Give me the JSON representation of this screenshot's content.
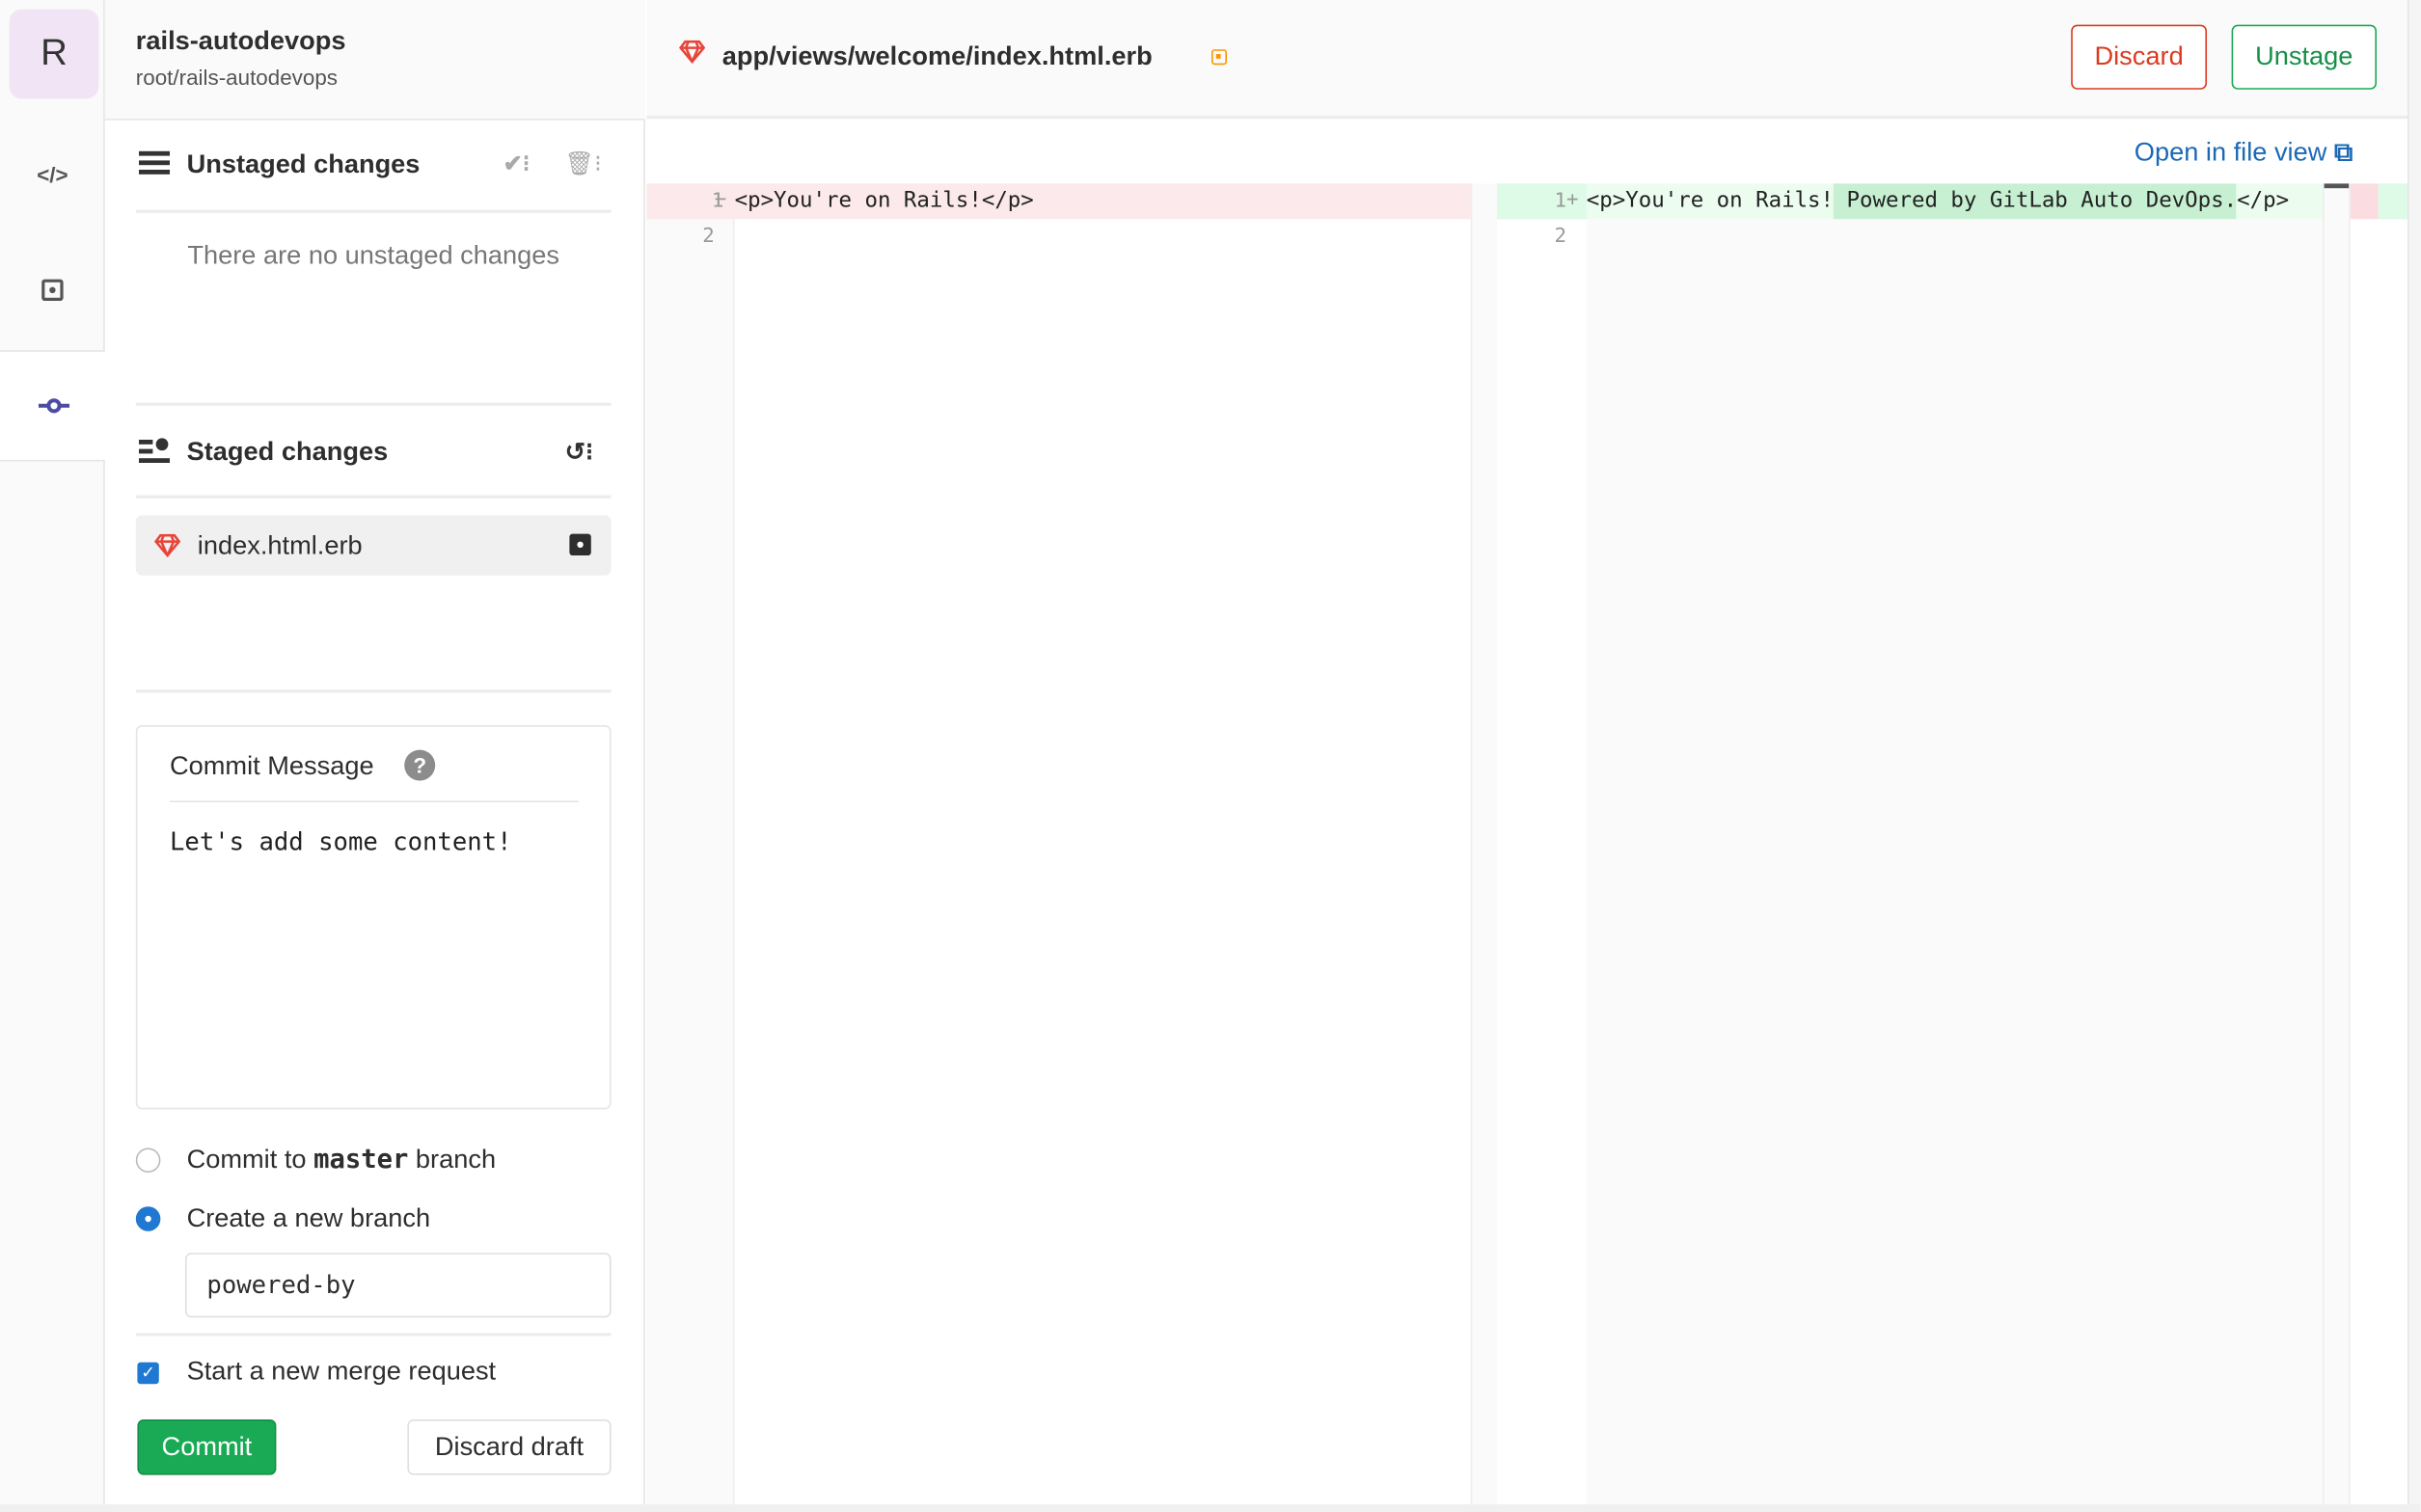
{
  "project": {
    "avatar_letter": "R",
    "name": "rails-autodevops",
    "path": "root/rails-autodevops"
  },
  "rail": {
    "items": [
      {
        "icon": "code-icon"
      },
      {
        "icon": "review-icon"
      },
      {
        "icon": "commit-icon",
        "active": true
      }
    ]
  },
  "unstaged": {
    "title": "Unstaged changes",
    "empty_text": "There are no unstaged changes"
  },
  "staged": {
    "title": "Staged changes",
    "files": [
      {
        "name": "index.html.erb",
        "icon": "ruby-gem-icon"
      }
    ]
  },
  "commit_form": {
    "message_label": "Commit Message",
    "message_value": "Let's add some content!",
    "option_master_prefix": "Commit to ",
    "option_master_branch": "master",
    "option_master_suffix": " branch",
    "option_new_branch": "Create a new branch",
    "selected_option": "new-branch",
    "branch_name": "powered-by",
    "merge_request_label": "Start a new merge request",
    "merge_request_checked": true,
    "commit_label": "Commit",
    "discard_draft_label": "Discard draft"
  },
  "editor": {
    "file_path": "app/views/welcome/index.html.erb",
    "discard_label": "Discard",
    "unstage_label": "Unstage",
    "open_file_view_label": "Open in file view",
    "left": {
      "lines": [
        {
          "num": "1",
          "marker": "−",
          "text": "<p>You're on Rails!</p>"
        },
        {
          "num": "2",
          "marker": "",
          "text": ""
        }
      ]
    },
    "right": {
      "lines": [
        {
          "num": "1",
          "marker": "+",
          "text_plain": "<p>You're on Rails!",
          "text_added": " Powered by GitLab Auto DevOps.",
          "text_end": "</p>"
        },
        {
          "num": "2",
          "marker": "",
          "text": ""
        }
      ]
    }
  },
  "colors": {
    "accent": "#4b4ba3",
    "danger": "#db3b21",
    "success": "#1aaa55",
    "link": "#1b69b6",
    "deleted_bg": "#fbe9eb",
    "added_bg": "#ecfdf0",
    "added_highlight": "#c7f0d2"
  }
}
